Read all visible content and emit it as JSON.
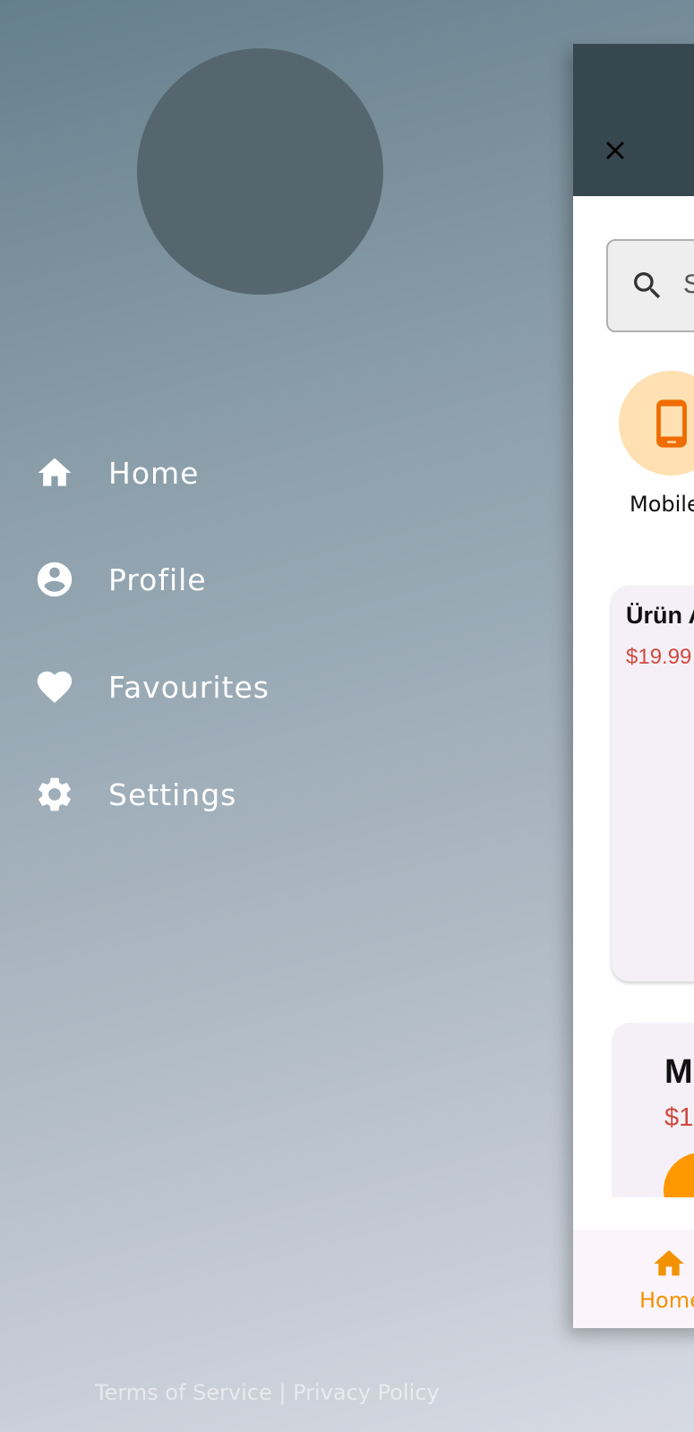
{
  "drawer": {
    "menu": [
      {
        "label": "Home",
        "icon": "home-icon"
      },
      {
        "label": "Profile",
        "icon": "account-circle-icon"
      },
      {
        "label": "Favourites",
        "icon": "heart-icon"
      },
      {
        "label": "Settings",
        "icon": "gear-icon"
      }
    ],
    "footer": {
      "terms": "Terms of Service",
      "separator": " | ",
      "privacy": "Privacy Policy"
    }
  },
  "app_preview": {
    "search_placeholder": "S",
    "category_label": "Mobile",
    "card1": {
      "title": "Ürün A",
      "price": "$19.99"
    },
    "card2": {
      "title": "M",
      "price": "$1"
    },
    "bottom_nav": {
      "home_label": "Home"
    }
  },
  "colors": {
    "appbar": "#37474f",
    "accent": "#ff9800",
    "price": "#d04a3f"
  }
}
